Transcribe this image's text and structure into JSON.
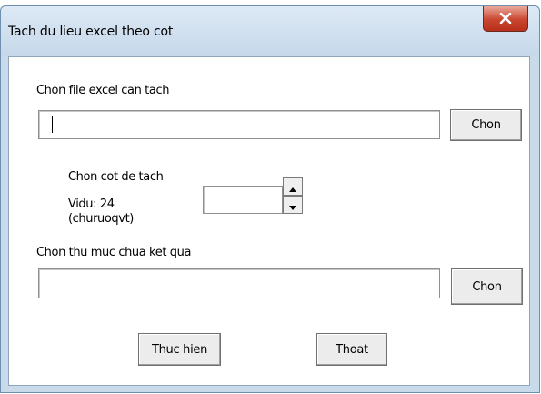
{
  "window": {
    "title": "Tach du lieu excel theo cot",
    "close_icon": "close-icon"
  },
  "file_section": {
    "label": "Chon file excel can tach",
    "value": "",
    "button_label": "Chon"
  },
  "column_section": {
    "label": "Chon cot de tach",
    "example_line1": "Vidu: 24",
    "example_line2": "(churuoqvt)",
    "value": ""
  },
  "folder_section": {
    "label": "Chon thu muc chua ket qua",
    "value": "",
    "button_label": "Chon"
  },
  "actions": {
    "run_label": "Thuc hien",
    "exit_label": "Thoat"
  }
}
